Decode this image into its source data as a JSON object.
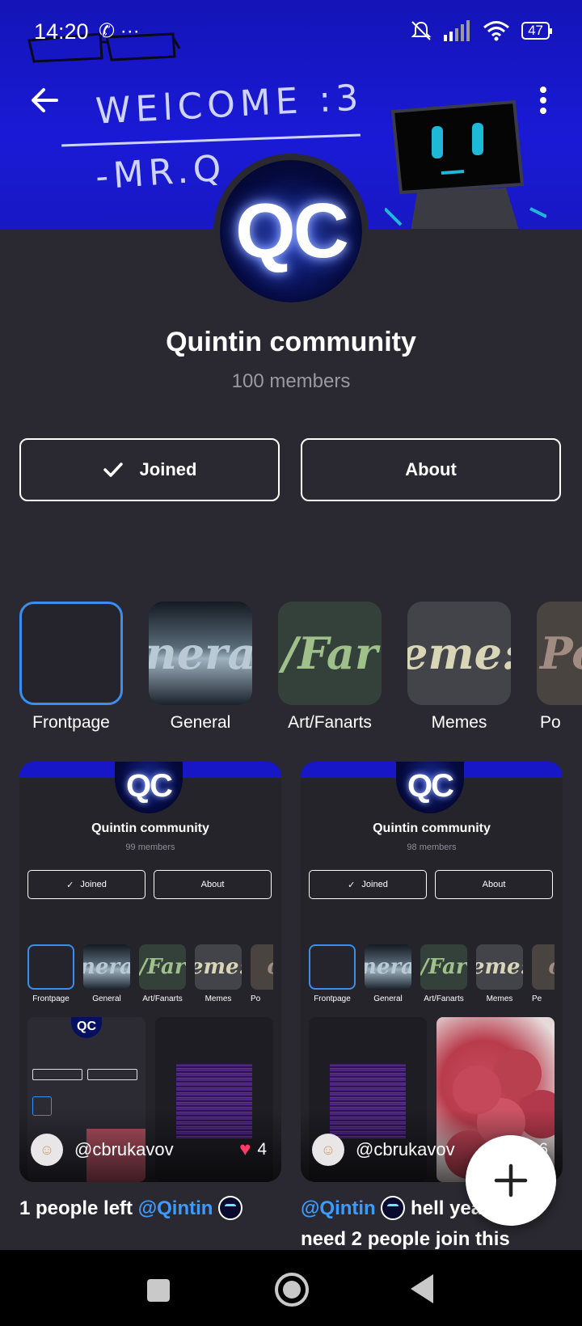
{
  "status_bar": {
    "time": "14:20",
    "left_icons": "✆ ···",
    "battery": "47"
  },
  "banner": {
    "line1": "WElCOME :3",
    "line2": "-MR.Q"
  },
  "community": {
    "avatar_text": "QC",
    "name": "Quintin community",
    "members": "100 members"
  },
  "actions": {
    "joined_label": "Joined",
    "about_label": "About"
  },
  "categories": [
    {
      "label": "Frontpage",
      "thumb_text": ""
    },
    {
      "label": "General",
      "thumb_text": "nera"
    },
    {
      "label": "Art/Fanarts",
      "thumb_text": "/Far"
    },
    {
      "label": "Memes",
      "thumb_text": "eme:"
    },
    {
      "label": "Po",
      "thumb_text": "Po"
    }
  ],
  "posts": [
    {
      "mini": {
        "avatar_text": "QC",
        "title": "Quintin community",
        "members": "99 members",
        "joined": "Joined",
        "about": "About",
        "cats": [
          "Frontpage",
          "General",
          "Art/Fanarts",
          "Memes",
          "Po"
        ],
        "cat_thumbs": [
          "",
          "nera",
          "/Far",
          "eme:",
          "o"
        ]
      },
      "username": "@cbrukavov",
      "likes": "4",
      "caption_prefix": "1 people left ",
      "caption_mention": "@Qintin",
      "caption_suffix": ""
    },
    {
      "mini": {
        "avatar_text": "QC",
        "title": "Quintin community",
        "members": "98 members",
        "joined": "Joined",
        "about": "About",
        "cats": [
          "Frontpage",
          "General",
          "Art/Fanarts",
          "Memes",
          "Pe"
        ],
        "cat_thumbs": [
          "",
          "nera",
          "/Far",
          "eme:",
          "o"
        ]
      },
      "username": "@cbrukavov",
      "likes": "6",
      "caption_prefix": "",
      "caption_mention": "@Qintin",
      "caption_suffix": " hell yeah we need 2 people join this"
    }
  ],
  "colors": {
    "background": "#2a2931",
    "accent": "#3c9bff",
    "banner": "#1a1ad6",
    "heart": "#ff3c69"
  },
  "icons": {
    "back": "arrow-left-icon",
    "more": "more-vertical-icon",
    "check": "check-icon",
    "heart": "heart-icon",
    "add": "plus-icon"
  }
}
